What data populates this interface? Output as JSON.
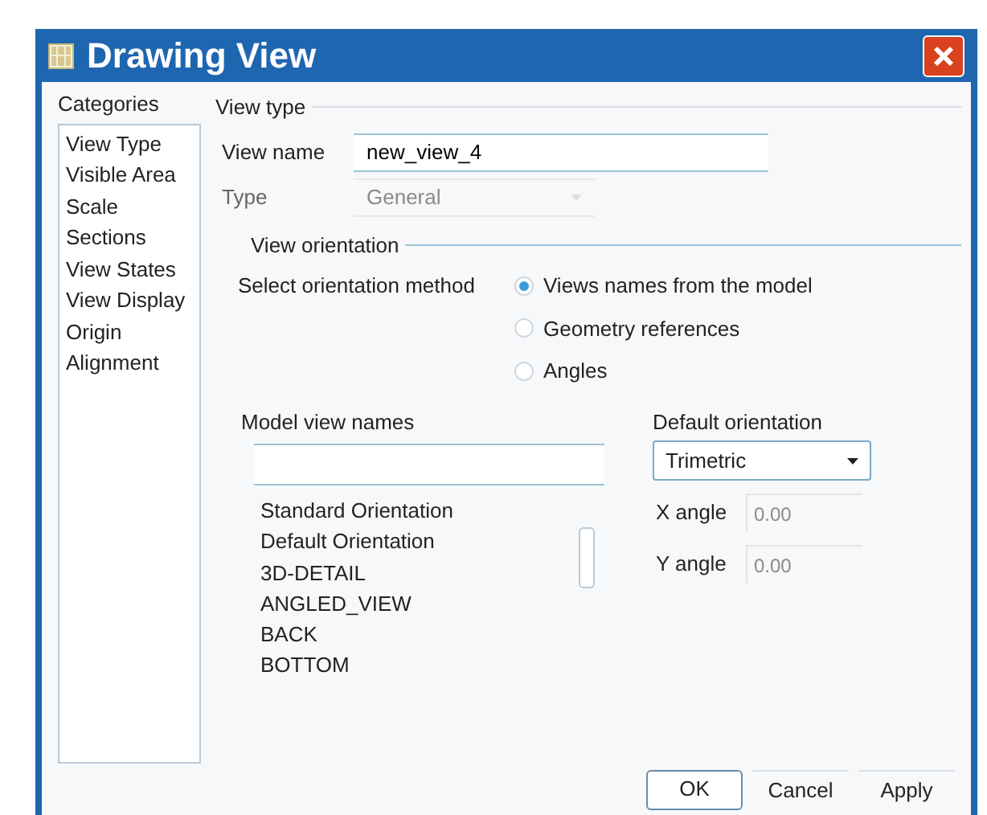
{
  "window": {
    "title": "Drawing View"
  },
  "categories": {
    "title": "Categories",
    "items": [
      {
        "label": "View Type",
        "selected": false
      },
      {
        "label": "Visible Area",
        "selected": false
      },
      {
        "label": "Scale",
        "selected": false
      },
      {
        "label": "Sections",
        "selected": false
      },
      {
        "label": "View States",
        "selected": false
      },
      {
        "label": "View Display",
        "selected": false
      },
      {
        "label": "Origin",
        "selected": false
      },
      {
        "label": "Alignment",
        "selected": false
      }
    ]
  },
  "view_type": {
    "title": "View type",
    "view_name": {
      "label": "View name",
      "value": "new_view_4"
    },
    "type": {
      "label": "Type",
      "value": "General",
      "disabled": true
    }
  },
  "view_orientation": {
    "title": "View orientation",
    "method_label": "Select orientation method",
    "methods": [
      {
        "label": "Views names from the model",
        "selected": true
      },
      {
        "label": "Geometry references",
        "selected": false
      },
      {
        "label": "Angles",
        "selected": false
      }
    ],
    "model_view_names": {
      "title": "Model view names",
      "items": [
        {
          "label": "Standard Orientation",
          "selected": false
        },
        {
          "label": "Default Orientation",
          "selected": false
        },
        {
          "label": "3D-DETAIL",
          "selected": false
        },
        {
          "label": "ANGLED_VIEW",
          "selected": false
        },
        {
          "label": "BACK",
          "selected": false
        },
        {
          "label": "BOTTOM",
          "selected": false
        }
      ]
    },
    "default_orientation": {
      "label": "Default orientation",
      "value": "Trimetric"
    },
    "angles": [
      {
        "label": "X angle",
        "value": "0.00",
        "disabled": true
      },
      {
        "label": "Y angle",
        "value": "0.00",
        "disabled": true
      }
    ]
  },
  "buttons": [
    {
      "label": "OK",
      "default": true
    },
    {
      "label": "Cancel",
      "default": false
    },
    {
      "label": "Apply",
      "default": false
    }
  ]
}
